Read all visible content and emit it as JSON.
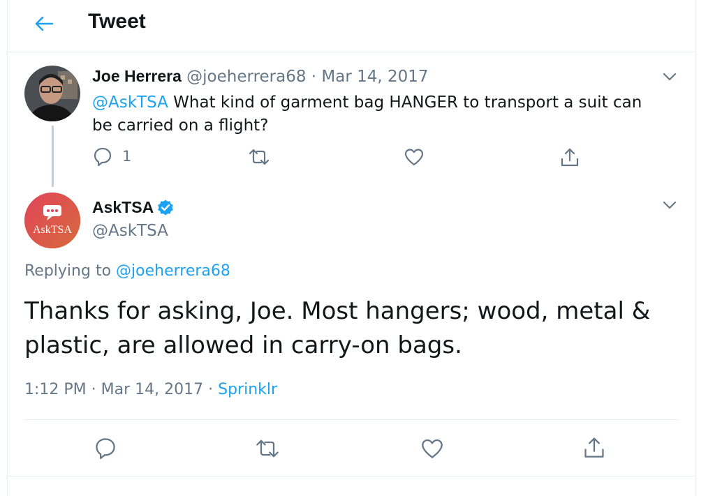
{
  "header": {
    "title": "Tweet",
    "back_icon": "arrow-left-icon"
  },
  "colors": {
    "accent": "#1da1f2",
    "text": "#14171a",
    "muted": "#657786",
    "border": "#e6ecf0",
    "tsa_badge": "#d9534f"
  },
  "parent_tweet": {
    "author_name": "Joe Herrera",
    "handle": "@joeherrera68",
    "separator": "·",
    "date": "Mar 14, 2017",
    "mention": "@AskTSA",
    "text": " What kind of garment bag HANGER to transport a suit can be carried on a flight?",
    "reply_count": "1"
  },
  "main_tweet": {
    "author_name": "AskTSA",
    "handle": "@AskTSA",
    "avatar_label": "AskTSA",
    "verified": true,
    "replying_label": "Replying to ",
    "replying_handle": "@joeherrera68",
    "text": "Thanks for asking, Joe. Most hangers; wood, metal & plastic, are allowed in carry-on bags.",
    "time": "1:12 PM",
    "separator": "·",
    "date": "Mar 14, 2017",
    "source": "Sprinklr"
  }
}
